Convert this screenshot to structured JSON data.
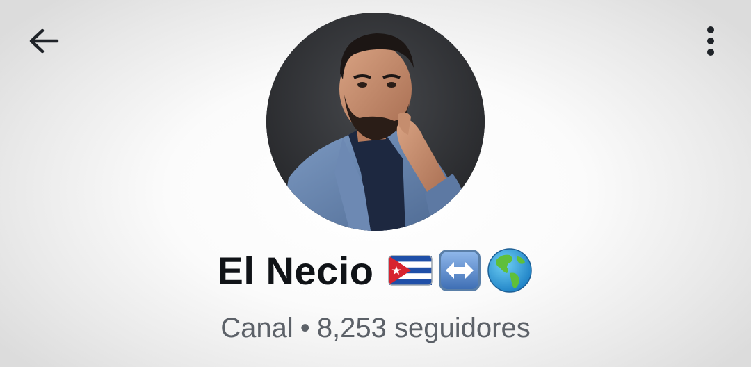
{
  "header": {
    "back_icon": "arrow-left-icon",
    "menu_icon": "more-vertical-icon"
  },
  "channel": {
    "name": "El Necio",
    "emojis": [
      "cuba-flag-emoji",
      "left-right-arrow-emoji",
      "globe-americas-emoji"
    ],
    "type": "Canal",
    "separator": "•",
    "followers": "8,253 seguidores"
  },
  "colors": {
    "title": "#101317",
    "subtitle": "#5c6168",
    "icon": "#1f2328"
  }
}
